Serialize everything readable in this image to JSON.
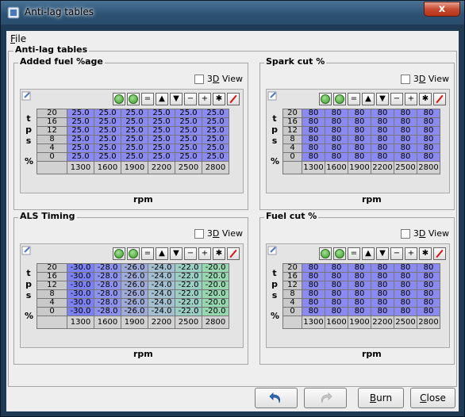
{
  "window": {
    "title": "Anti-lag tables",
    "close_label": "x"
  },
  "menu": {
    "file": "File"
  },
  "outer_title": "Anti-lag tables",
  "view3d_label": "3D View",
  "y_axis_letters": [
    "t",
    "p",
    "s",
    "%"
  ],
  "toolbar": {
    "equal": "=",
    "up": "▲",
    "down": "▼",
    "minus": "−",
    "plus": "+",
    "multiply": "✱"
  },
  "panels": [
    {
      "title": "Added fuel %age",
      "y_labels": [
        "20",
        "16",
        "12",
        "8",
        "4",
        "0"
      ],
      "x_labels": [
        "1300",
        "1600",
        "1900",
        "2200",
        "2500",
        "2800"
      ],
      "x_axis": "rpm",
      "rows": [
        [
          "25.0",
          "25.0",
          "25.0",
          "25.0",
          "25.0",
          "25.0"
        ],
        [
          "25.0",
          "25.0",
          "25.0",
          "25.0",
          "25.0",
          "25.0"
        ],
        [
          "25.0",
          "25.0",
          "25.0",
          "25.0",
          "25.0",
          "25.0"
        ],
        [
          "25.0",
          "25.0",
          "25.0",
          "25.0",
          "25.0",
          "25.0"
        ],
        [
          "25.0",
          "25.0",
          "25.0",
          "25.0",
          "25.0",
          "25.0"
        ],
        [
          "25.0",
          "25.0",
          "25.0",
          "25.0",
          "25.0",
          "25.0"
        ]
      ]
    },
    {
      "title": "Spark cut %",
      "y_labels": [
        "20",
        "16",
        "12",
        "8",
        "4",
        "0"
      ],
      "x_labels": [
        "1300",
        "1600",
        "1900",
        "2200",
        "2500",
        "2800"
      ],
      "x_axis": "rpm",
      "rows": [
        [
          "80",
          "80",
          "80",
          "80",
          "80",
          "80"
        ],
        [
          "80",
          "80",
          "80",
          "80",
          "80",
          "80"
        ],
        [
          "80",
          "80",
          "80",
          "80",
          "80",
          "80"
        ],
        [
          "80",
          "80",
          "80",
          "80",
          "80",
          "80"
        ],
        [
          "80",
          "80",
          "80",
          "80",
          "80",
          "80"
        ],
        [
          "80",
          "80",
          "80",
          "80",
          "80",
          "80"
        ]
      ]
    },
    {
      "title": "ALS Timing",
      "y_labels": [
        "20",
        "16",
        "12",
        "8",
        "4",
        "0"
      ],
      "x_labels": [
        "1300",
        "1600",
        "1900",
        "2200",
        "2500",
        "2800"
      ],
      "x_axis": "rpm",
      "rows": [
        [
          "-30.0",
          "-28.0",
          "-26.0",
          "-24.0",
          "-22.0",
          "-20.0"
        ],
        [
          "-30.0",
          "-28.0",
          "-26.0",
          "-24.0",
          "-22.0",
          "-20.0"
        ],
        [
          "-30.0",
          "-28.0",
          "-26.0",
          "-24.0",
          "-22.0",
          "-20.0"
        ],
        [
          "-30.0",
          "-28.0",
          "-26.0",
          "-24.0",
          "-22.0",
          "-20.0"
        ],
        [
          "-30.0",
          "-28.0",
          "-26.0",
          "-24.0",
          "-22.0",
          "-20.0"
        ],
        [
          "-30.0",
          "-28.0",
          "-26.0",
          "-24.0",
          "-22.0",
          "-20.0"
        ]
      ],
      "col_colors": [
        "#7b80f2",
        "#8c92ee",
        "#9eaad8",
        "#a3c0d0",
        "#9ccfc4",
        "#95d8b0"
      ]
    },
    {
      "title": "Fuel cut %",
      "y_labels": [
        "20",
        "16",
        "12",
        "8",
        "4",
        "0"
      ],
      "x_labels": [
        "1300",
        "1600",
        "1900",
        "2200",
        "2500",
        "2800"
      ],
      "x_axis": "rpm",
      "rows": [
        [
          "80",
          "80",
          "80",
          "80",
          "80",
          "80"
        ],
        [
          "80",
          "80",
          "80",
          "80",
          "80",
          "80"
        ],
        [
          "80",
          "80",
          "80",
          "80",
          "80",
          "80"
        ],
        [
          "80",
          "80",
          "80",
          "80",
          "80",
          "80"
        ],
        [
          "80",
          "80",
          "80",
          "80",
          "80",
          "80"
        ],
        [
          "80",
          "80",
          "80",
          "80",
          "80",
          "80"
        ]
      ]
    }
  ],
  "buttons": {
    "burn": "Burn",
    "close": "Close"
  }
}
